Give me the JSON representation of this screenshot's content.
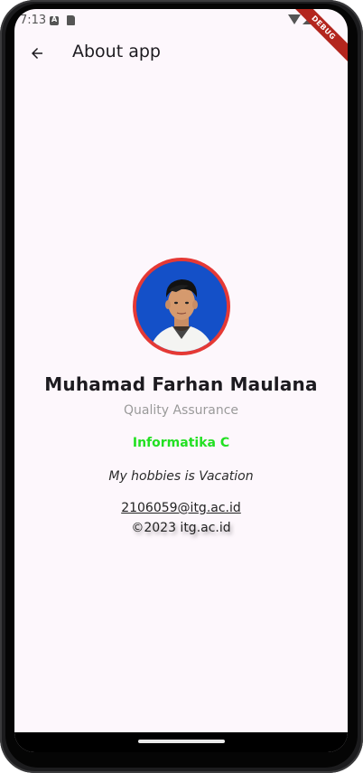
{
  "status_bar": {
    "time": "7:13",
    "icons": [
      "a-icon",
      "sd-card-icon",
      "wifi-icon",
      "signal-icon"
    ]
  },
  "debug_banner": "DEBUG",
  "app_bar": {
    "back_icon": "arrow-back-icon",
    "title": "About app"
  },
  "profile": {
    "avatar_ring_color": "#e53935",
    "avatar_bg_color": "#1450c8",
    "name": "Muhamad Farhan Maulana",
    "role": "Quality Assurance",
    "class": "Informatika C",
    "class_color": "#22e022",
    "hobby": "My hobbies is Vacation",
    "email": "2106059@itg.ac.id",
    "copyright": "©2023 itg.ac.id"
  }
}
